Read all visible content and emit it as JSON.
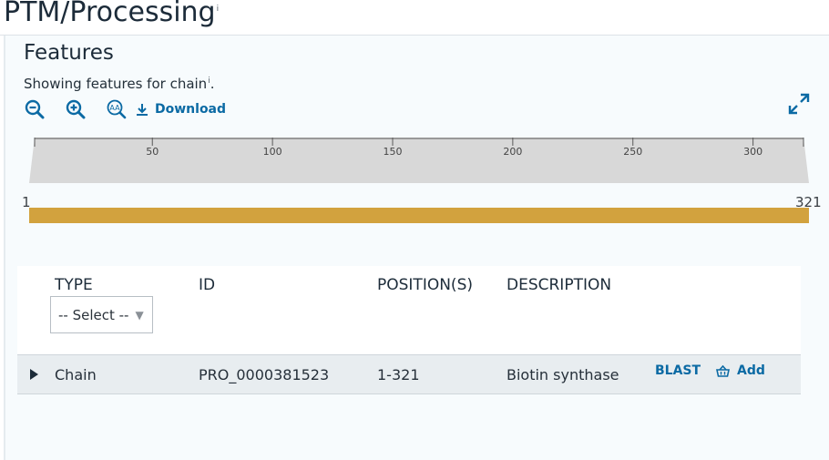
{
  "page": {
    "title": "PTM/Processing",
    "info_mark": "i"
  },
  "section": {
    "title": "Features",
    "subtitle_prefix": "Showing features for chain",
    "subtitle_info": "i",
    "subtitle_suffix": "."
  },
  "toolbar": {
    "zoom_out_icon": "zoom-out-icon",
    "zoom_in_icon": "zoom-in-icon",
    "font_icon": "text-size-icon",
    "download_label": "Download",
    "expand_icon": "expand-icon"
  },
  "ruler": {
    "start": "1",
    "end": "321",
    "min": 1,
    "max": 321,
    "ticks": [
      "50",
      "100",
      "150",
      "200",
      "250",
      "300"
    ]
  },
  "track": {
    "feature": "Chain",
    "range": [
      1,
      321
    ],
    "color": "#d2a23e"
  },
  "table": {
    "headers": {
      "type": "TYPE",
      "id": "ID",
      "positions": "POSITION(S)",
      "description": "DESCRIPTION"
    },
    "type_filter": {
      "selected": "-- Select --"
    },
    "rows": [
      {
        "type": "Chain",
        "id": "PRO_0000381523",
        "positions": "1-321",
        "description": "Biotin synthase",
        "blast_label": "BLAST",
        "add_label": "Add"
      }
    ]
  },
  "colors": {
    "link": "#0b6aa4",
    "chain": "#d2a23e",
    "ruler": "#d8d8d8"
  }
}
